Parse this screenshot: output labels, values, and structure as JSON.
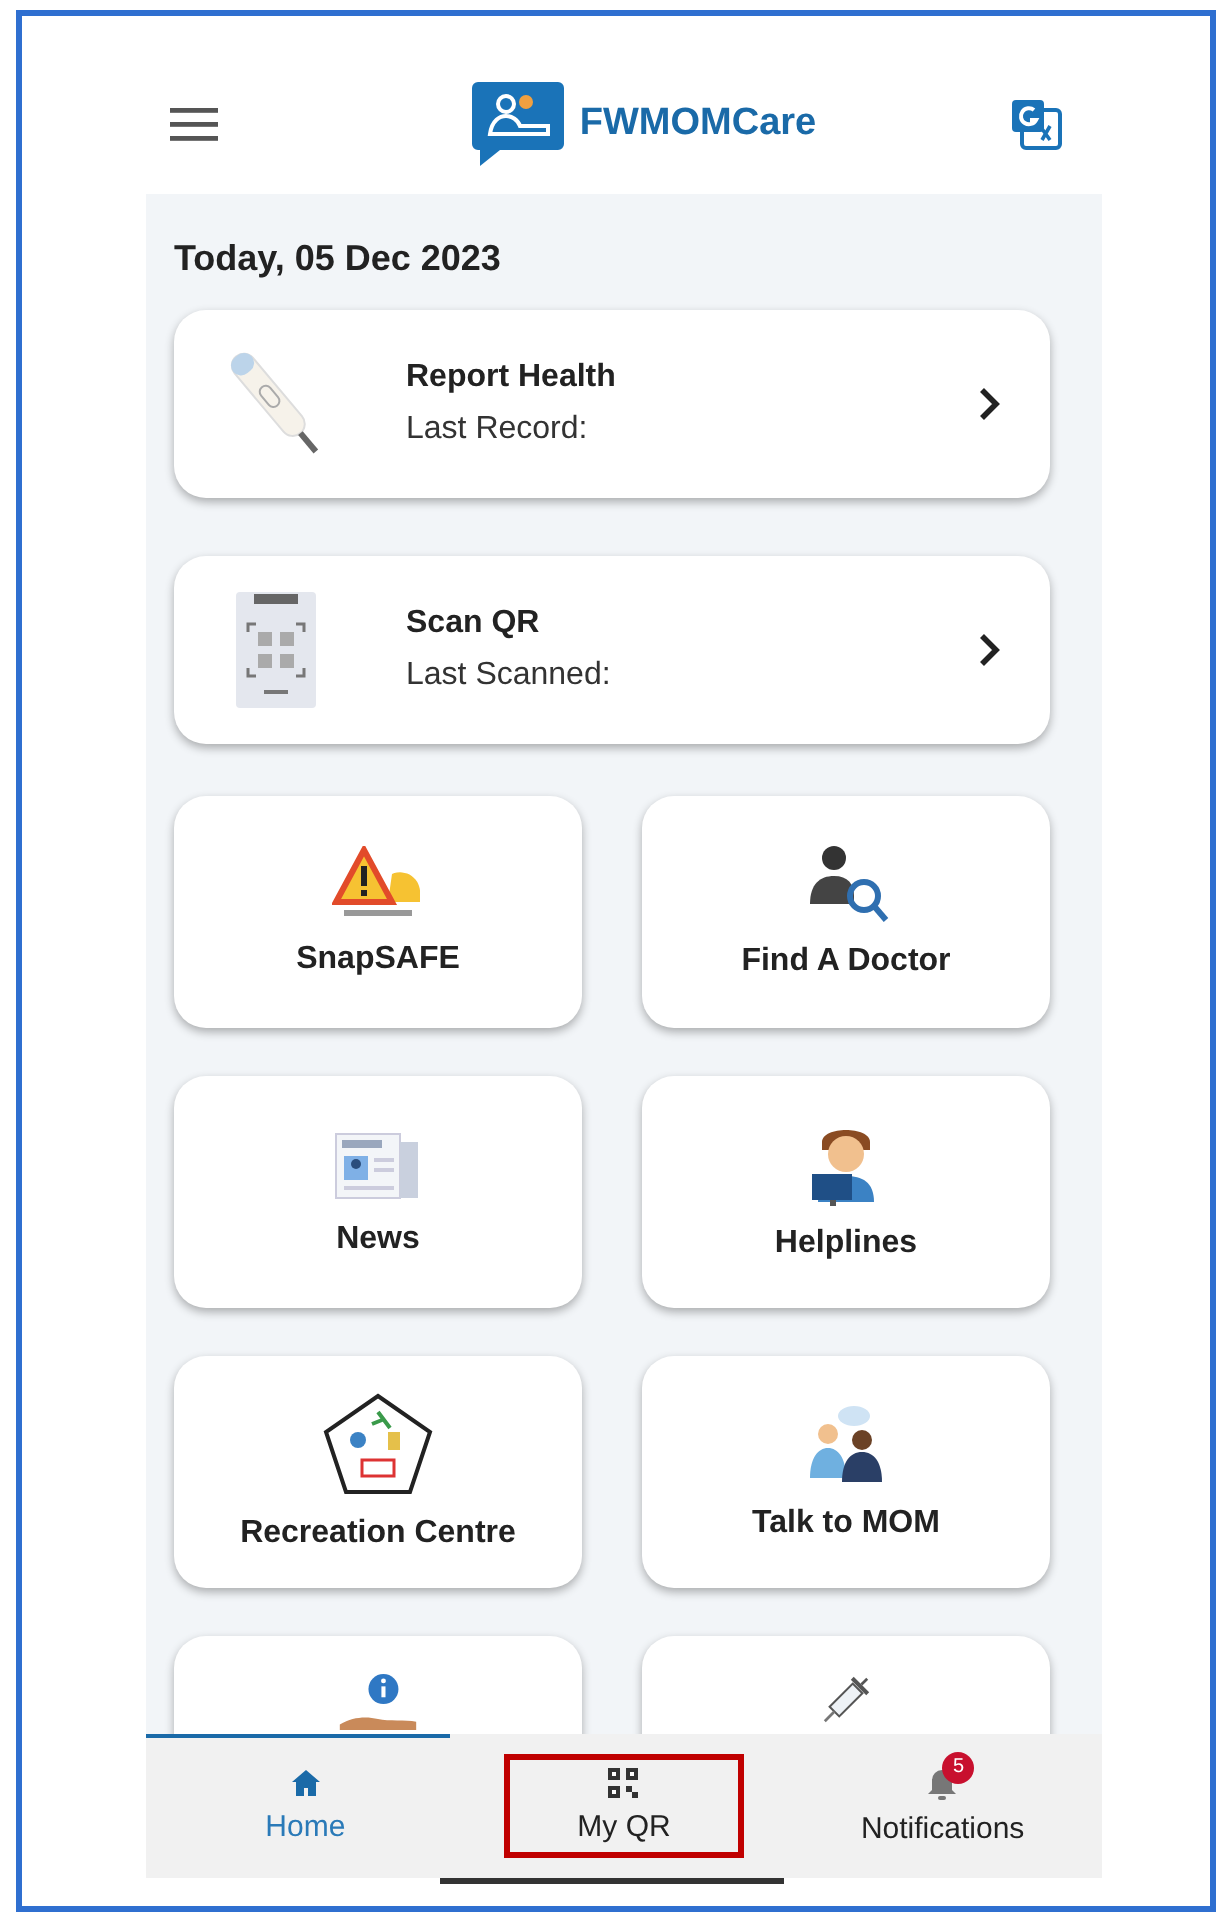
{
  "header": {
    "title": "FWMOMCare"
  },
  "date": "Today, 05 Dec 2023",
  "list_cards": [
    {
      "kind": "thermometer",
      "title": "Report Health",
      "subtitle": "Last Record:"
    },
    {
      "kind": "scanner",
      "title": "Scan QR",
      "subtitle": "Last Scanned:"
    }
  ],
  "tiles": [
    {
      "kind": "warning",
      "label": "SnapSAFE"
    },
    {
      "kind": "doctor",
      "label": "Find A Doctor"
    },
    {
      "kind": "news",
      "label": "News"
    },
    {
      "kind": "helpline",
      "label": "Helplines"
    },
    {
      "kind": "recreation",
      "label": "Recreation Centre"
    },
    {
      "kind": "talk",
      "label": "Talk to MOM"
    },
    {
      "kind": "info"
    },
    {
      "kind": "syringe"
    }
  ],
  "nav": [
    {
      "kind": "home",
      "label": "Home",
      "selected": true,
      "highlighted": false
    },
    {
      "kind": "qr",
      "label": "My QR",
      "selected": false,
      "highlighted": true
    },
    {
      "kind": "bell",
      "label": "Notifications",
      "selected": false,
      "highlighted": false,
      "badge": "5"
    }
  ]
}
